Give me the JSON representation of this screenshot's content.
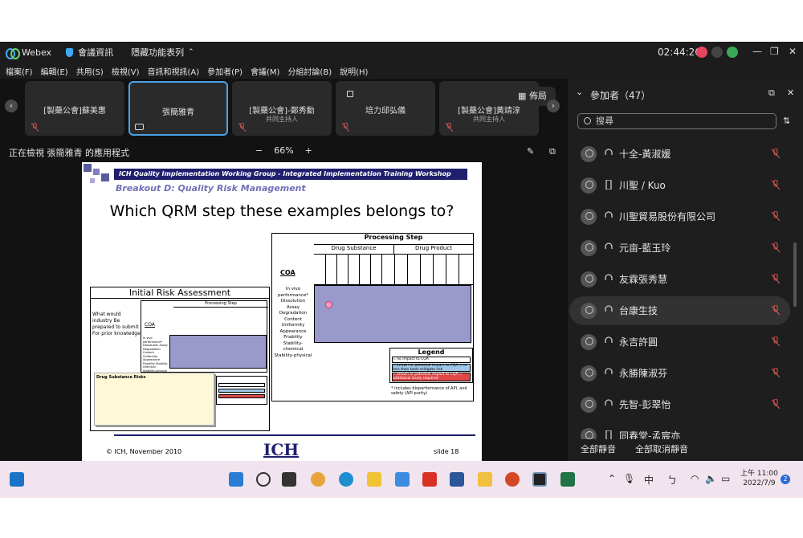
{
  "titlebar": {
    "app": "Webex",
    "info": "會議資訊",
    "hidden": "隱藏功能表列",
    "timer": "02:44:26"
  },
  "menu": [
    "檔案(F)",
    "編輯(E)",
    "共用(S)",
    "檢視(V)",
    "音訊和視訊(A)",
    "參加者(P)",
    "會議(M)",
    "分組討論(B)",
    "說明(H)"
  ],
  "tiles": [
    {
      "name": "[製藥公會]蘇美惠",
      "sub": ""
    },
    {
      "name": "張簡雅青",
      "sub": ""
    },
    {
      "name": "[製藥公會]-鄭秀勳",
      "sub": "共同主持人"
    },
    {
      "name": "培力邱弘儀",
      "sub": ""
    },
    {
      "name": "[製藥公會]黃靖淳",
      "sub": "共同主持人"
    }
  ],
  "layout_label": "佈局",
  "viewing": {
    "text": "正在檢視 張簡雅青 的應用程式",
    "minus": "−",
    "zoom": "66%",
    "plus": "+"
  },
  "slide": {
    "header": "ICH Quality Implementation Working Group - Integrated Implementation Training Workshop",
    "subheader": "Breakout D: Quality Risk Management",
    "title": "Which QRM step these examples belongs to?",
    "left_box_title": "Initial Risk Assessment",
    "left_box_text": "What would industry Be prepared to submit For prior knowledge",
    "processing_step": "Processing Step",
    "drug_substance": "Drug Substance",
    "drug_product": "Drug Product",
    "coa": "COA",
    "coa_list": "In vivo performance* Dissolution Assay Degradation Content Uniformity Appearance Friability Stability-chemical Stability-physical",
    "legend": "Legend",
    "legend_items": [
      "= no impact to CQA",
      "= known or potential impact to CQA = or less than tools mitigate risk",
      "= known or potential impact to CQA = additional study required"
    ],
    "legend_note": "* includes bioperformance of API, and safety (API purity)",
    "note_box_title": "Drug Substance Risks",
    "footer_left": "© ICH, November 2010",
    "footer_logo": "ICH",
    "footer_right": "slide 18"
  },
  "participants": {
    "header": "參加者（47）",
    "search_placeholder": "搜尋",
    "list": [
      "十全-黃淑媛",
      "川聖 / Kuo",
      "川聖貿易股份有限公司",
      "元亩-藍玉玲",
      "友霖張秀慧",
      "台康生技",
      "永吉許圓",
      "永勝陳淑芬",
      "先智-彭翠怡",
      "同春堂-孟宸亦"
    ],
    "mute_all": "全部靜音",
    "unmute_all": "全部取消靜音"
  },
  "taskbar": {
    "ime1": "中",
    "ime2": "ㄅ",
    "time": "上午 11:00",
    "date": "2022/7/9",
    "badge": "2"
  },
  "colors": {
    "accent": "#4aa3e8",
    "muted": "#e05a5a",
    "slide_purple": "#9999cc"
  }
}
